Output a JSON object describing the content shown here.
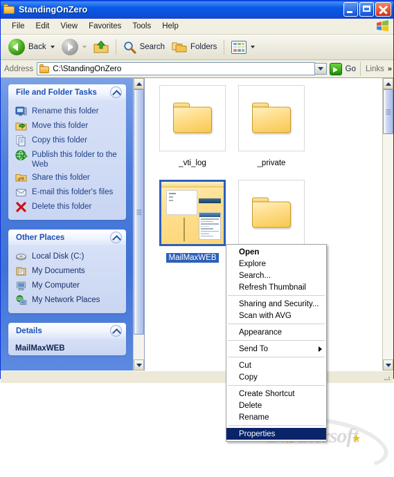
{
  "window": {
    "title": "StandingOnZero",
    "title_icon": "folder-icon",
    "controls": {
      "minimize": "Minimize",
      "maximize": "Maximize",
      "close": "Close"
    }
  },
  "menubar": {
    "items": [
      {
        "label": "File"
      },
      {
        "label": "Edit"
      },
      {
        "label": "View"
      },
      {
        "label": "Favorites"
      },
      {
        "label": "Tools"
      },
      {
        "label": "Help"
      }
    ],
    "logo_icon": "windows-flag-icon"
  },
  "toolbar": {
    "back": {
      "label": "Back",
      "icon": "back-arrow-icon",
      "dropdown_icon": "chevron-down-icon"
    },
    "forward": {
      "label": "",
      "icon": "forward-arrow-icon",
      "dropdown_icon": "chevron-down-icon"
    },
    "up": {
      "label": "",
      "icon": "up-folder-icon"
    },
    "search": {
      "label": "Search",
      "icon": "magnifier-icon"
    },
    "folders": {
      "label": "Folders",
      "icon": "folders-icon"
    },
    "views": {
      "label": "",
      "icon": "views-grid-icon",
      "dropdown_icon": "chevron-down-icon"
    }
  },
  "addressbar": {
    "label": "Address",
    "icon": "folder-icon",
    "value": "C:\\StandingOnZero",
    "placeholder": "C:\\StandingOnZero",
    "dropdown_icon": "chevron-down-icon",
    "go_label": "Go",
    "go_icon": "green-arrow-icon",
    "links_label": "Links",
    "links_chevron": "»"
  },
  "sidebar": {
    "panels": [
      {
        "title": "File and Folder Tasks",
        "collapse_icon": "chevron-up-icon",
        "items": [
          {
            "label": "Rename this folder",
            "icon": "rename-icon"
          },
          {
            "label": "Move this folder",
            "icon": "move-folder-icon"
          },
          {
            "label": "Copy this folder",
            "icon": "copy-icon"
          },
          {
            "label": "Publish this folder to the Web",
            "icon": "publish-web-icon"
          },
          {
            "label": "Share this folder",
            "icon": "share-folder-icon"
          },
          {
            "label": "E-mail this folder's files",
            "icon": "email-icon"
          },
          {
            "label": "Delete this folder",
            "icon": "delete-x-icon"
          }
        ]
      },
      {
        "title": "Other Places",
        "collapse_icon": "chevron-up-icon",
        "items": [
          {
            "label": "Local Disk (C:)",
            "icon": "hard-disk-icon"
          },
          {
            "label": "My Documents",
            "icon": "my-documents-icon"
          },
          {
            "label": "My Computer",
            "icon": "my-computer-icon"
          },
          {
            "label": "My Network Places",
            "icon": "network-places-icon"
          }
        ]
      },
      {
        "title": "Details",
        "collapse_icon": "chevron-up-icon",
        "detail_name": "MailMaxWEB"
      }
    ]
  },
  "files": {
    "view_mode": "thumbnails",
    "items": [
      {
        "name": "_vti_log",
        "type": "folder",
        "selected": false
      },
      {
        "name": "_private",
        "type": "folder",
        "selected": false
      },
      {
        "name": "MailMaxWEB",
        "type": "folder-thumbnail",
        "selected": true
      },
      {
        "name": "",
        "type": "folder",
        "selected": false
      }
    ]
  },
  "context_menu": {
    "groups": [
      [
        {
          "label": "Open",
          "bold": true,
          "highlighted": false
        },
        {
          "label": "Explore",
          "bold": false,
          "highlighted": false
        },
        {
          "label": "Search...",
          "bold": false,
          "highlighted": false
        },
        {
          "label": "Refresh Thumbnail",
          "bold": false,
          "highlighted": false
        }
      ],
      [
        {
          "label": "Sharing and Security...",
          "bold": false,
          "highlighted": false
        },
        {
          "label": "Scan with AVG",
          "bold": false,
          "highlighted": false
        }
      ],
      [
        {
          "label": "Appearance",
          "bold": false,
          "highlighted": false
        }
      ],
      [
        {
          "label": "Send To",
          "bold": false,
          "highlighted": false,
          "submenu": true
        }
      ],
      [
        {
          "label": "Cut",
          "bold": false,
          "highlighted": false
        },
        {
          "label": "Copy",
          "bold": false,
          "highlighted": false
        }
      ],
      [
        {
          "label": "Create Shortcut",
          "bold": false,
          "highlighted": false
        },
        {
          "label": "Delete",
          "bold": false,
          "highlighted": false
        },
        {
          "label": "Rename",
          "bold": false,
          "highlighted": false
        }
      ],
      [
        {
          "label": "Properties",
          "bold": false,
          "highlighted": true
        }
      ]
    ]
  },
  "watermark": {
    "text": "Brothersoft"
  },
  "colors": {
    "title_blue": "#0a5ae8",
    "selection_blue": "#2c5fbb",
    "menu_highlight": "#0a246a",
    "sidebar_blue": "#4f7fdc",
    "panel_header_text": "#1c4fb5",
    "link_text": "#1c3f87",
    "folder_yellow": "#f7c74e"
  }
}
